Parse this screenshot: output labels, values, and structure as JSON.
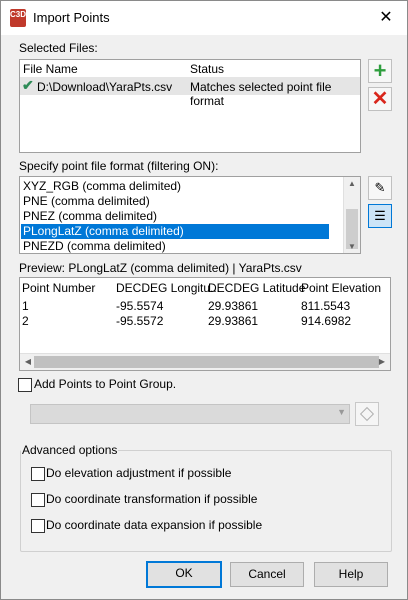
{
  "window": {
    "title": "Import Points",
    "close": "✕"
  },
  "selected_files": {
    "label": "Selected Files:",
    "columns": [
      "File Name",
      "Status"
    ],
    "rows": [
      {
        "file": "D:\\Download\\YaraPts.csv",
        "status": "Matches selected point file format"
      }
    ]
  },
  "format": {
    "label": "Specify point file format (filtering ON):",
    "items": [
      "XYZ_RGB (comma delimited)",
      "PNE (comma delimited)",
      "PNEZ (comma delimited)",
      "PLongLatZ (comma delimited)",
      "PNEZD (comma delimited)"
    ],
    "selected_index": 3
  },
  "preview": {
    "label": "Preview: PLongLatZ (comma delimited) | YaraPts.csv",
    "columns": [
      "Point Number",
      "DECDEG Longitu...",
      "DECDEG Latitude",
      "Point Elevation"
    ],
    "rows": [
      [
        "1",
        "-95.5574",
        "29.93861",
        "811.5543"
      ],
      [
        "2",
        "-95.5572",
        "29.93861",
        "914.6982"
      ]
    ]
  },
  "group": {
    "label": "Add Points to Point Group.",
    "checked": false
  },
  "advanced": {
    "label": "Advanced options",
    "options": [
      "Do elevation adjustment if possible",
      "Do coordinate transformation if possible",
      "Do coordinate data expansion if possible"
    ]
  },
  "buttons": {
    "ok": "OK",
    "cancel": "Cancel",
    "help": "Help"
  },
  "icons": {
    "app": "C3D"
  }
}
